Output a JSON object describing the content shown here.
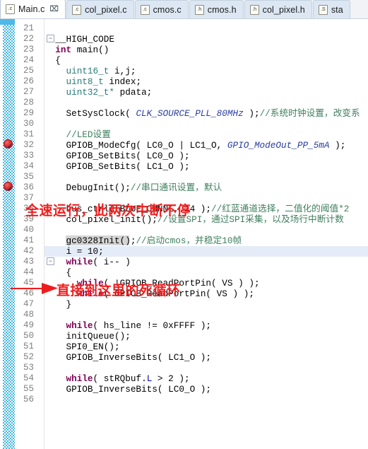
{
  "window": {
    "title": "Main.c - C/C++ Editor"
  },
  "tabs": [
    {
      "label": "Main.c",
      "icon": "c-file-icon",
      "icon_glyph": ".c",
      "active": true,
      "closable": true
    },
    {
      "label": "col_pixel.c",
      "icon": "c-file-icon",
      "icon_glyph": ".c",
      "active": false,
      "closable": false
    },
    {
      "label": "cmos.c",
      "icon": "c-file-icon",
      "icon_glyph": ".c",
      "active": false,
      "closable": false
    },
    {
      "label": "cmos.h",
      "icon": "h-file-icon",
      "icon_glyph": ".h",
      "active": false,
      "closable": false
    },
    {
      "label": "col_pixel.h",
      "icon": "h-file-icon",
      "icon_glyph": ".h",
      "active": false,
      "closable": false
    },
    {
      "label": "sta",
      "icon": "s-file-icon",
      "icon_glyph": ".S",
      "active": false,
      "closable": false
    }
  ],
  "editor": {
    "close_glyph": "⌧",
    "fold_glyph": "⊖",
    "breakpoint_lines": [
      32,
      36
    ],
    "selected_line": 42,
    "occurrence_highlight_line": 41,
    "first_visible_line": 21,
    "lines": [
      {
        "n": 21,
        "fold": false,
        "segments": []
      },
      {
        "n": 22,
        "fold": true,
        "segments": [
          {
            "t": "  __HIGH_CODE",
            "c": "mac"
          }
        ]
      },
      {
        "n": 23,
        "fold": false,
        "segments": [
          {
            "t": "  ",
            "c": "plain"
          },
          {
            "t": "int",
            "c": "kw"
          },
          {
            "t": " main()",
            "c": "plain"
          }
        ]
      },
      {
        "n": 24,
        "fold": false,
        "segments": [
          {
            "t": "  {",
            "c": "plain"
          }
        ]
      },
      {
        "n": 25,
        "fold": false,
        "segments": [
          {
            "t": "    ",
            "c": "plain"
          },
          {
            "t": "uint16_t",
            "c": "typ"
          },
          {
            "t": " i,j;",
            "c": "plain"
          }
        ]
      },
      {
        "n": 26,
        "fold": false,
        "segments": [
          {
            "t": "    ",
            "c": "plain"
          },
          {
            "t": "uint8_t",
            "c": "typ"
          },
          {
            "t": " index;",
            "c": "plain"
          }
        ]
      },
      {
        "n": 27,
        "fold": false,
        "segments": [
          {
            "t": "    ",
            "c": "plain"
          },
          {
            "t": "uint32_t*",
            "c": "typ"
          },
          {
            "t": " pdata;",
            "c": "plain"
          }
        ]
      },
      {
        "n": 28,
        "fold": false,
        "segments": []
      },
      {
        "n": 29,
        "fold": false,
        "segments": [
          {
            "t": "    SetSysClock( ",
            "c": "plain"
          },
          {
            "t": "CLK_SOURCE_PLL_80MHz",
            "c": "cnst"
          },
          {
            "t": " );",
            "c": "plain"
          },
          {
            "t": "//系统时钟设置，改变系",
            "c": "cmt"
          }
        ]
      },
      {
        "n": 30,
        "fold": false,
        "segments": []
      },
      {
        "n": 31,
        "fold": false,
        "segments": [
          {
            "t": "    ",
            "c": "plain"
          },
          {
            "t": "//LED设置",
            "c": "cmt"
          }
        ]
      },
      {
        "n": 32,
        "fold": false,
        "segments": [
          {
            "t": "    GPIOB_ModeCfg( LC0_O | LC1_O, ",
            "c": "plain"
          },
          {
            "t": "GPIO_ModeOut_PP_5mA",
            "c": "cnst"
          },
          {
            "t": " );",
            "c": "plain"
          }
        ]
      },
      {
        "n": 33,
        "fold": false,
        "segments": [
          {
            "t": "    GPIOB_SetBits( LC0_O );",
            "c": "plain"
          }
        ]
      },
      {
        "n": 34,
        "fold": false,
        "segments": [
          {
            "t": "    GPIOB_SetBits( LC1_O );",
            "c": "plain"
          }
        ]
      },
      {
        "n": 35,
        "fold": false,
        "segments": []
      },
      {
        "n": 36,
        "fold": false,
        "segments": [
          {
            "t": "    DebugInit();",
            "c": "plain"
          },
          {
            "t": "//串口通讯设置，默认",
            "c": "cmt"
          }
        ]
      },
      {
        "n": 37,
        "fold": false,
        "segments": []
      },
      {
        "n": 38,
        "fold": false,
        "segments": [
          {
            "t": "    bus_ctrl( BLUE_CHNNL, 14 );",
            "c": "plain"
          },
          {
            "t": "//红蓝通道选择，二值化的阈值*2",
            "c": "cmt"
          }
        ]
      },
      {
        "n": 39,
        "fold": false,
        "segments": [
          {
            "t": "    col_pixel_init();",
            "c": "plain"
          },
          {
            "t": "//设置SPI，通过SPI采集，以及场行中断计数",
            "c": "cmt"
          }
        ]
      },
      {
        "n": 40,
        "fold": false,
        "segments": []
      },
      {
        "n": 41,
        "fold": false,
        "segments": [
          {
            "t": "    gc0328Init();",
            "c": "plain"
          },
          {
            "t": "//启动cmos，并稳定10帧",
            "c": "cmt"
          }
        ]
      },
      {
        "n": 42,
        "fold": false,
        "segments": [
          {
            "t": "    i = 10;",
            "c": "plain"
          }
        ]
      },
      {
        "n": 43,
        "fold": true,
        "segments": [
          {
            "t": "    ",
            "c": "plain"
          },
          {
            "t": "while",
            "c": "kw"
          },
          {
            "t": "( i-- )",
            "c": "plain"
          }
        ]
      },
      {
        "n": 44,
        "fold": false,
        "segments": [
          {
            "t": "    {",
            "c": "plain"
          }
        ]
      },
      {
        "n": 45,
        "fold": false,
        "segments": [
          {
            "t": "      ",
            "c": "plain"
          },
          {
            "t": "while",
            "c": "kw"
          },
          {
            "t": "( !GPIOB_ReadPortPin( VS ) );",
            "c": "plain"
          }
        ]
      },
      {
        "n": 46,
        "fold": false,
        "segments": [
          {
            "t": "      ",
            "c": "plain"
          },
          {
            "t": "while",
            "c": "kw"
          },
          {
            "t": "( GPIOB_ReadPortPin( VS ) );",
            "c": "plain"
          }
        ]
      },
      {
        "n": 47,
        "fold": false,
        "segments": [
          {
            "t": "    }",
            "c": "plain"
          }
        ]
      },
      {
        "n": 48,
        "fold": false,
        "segments": []
      },
      {
        "n": 49,
        "fold": false,
        "segments": [
          {
            "t": "    ",
            "c": "plain"
          },
          {
            "t": "while",
            "c": "kw"
          },
          {
            "t": "( hs_line != 0xFFFF );",
            "c": "plain"
          }
        ]
      },
      {
        "n": 50,
        "fold": false,
        "segments": [
          {
            "t": "    initQueue();",
            "c": "plain"
          }
        ]
      },
      {
        "n": 51,
        "fold": false,
        "segments": [
          {
            "t": "    SPI0_EN();",
            "c": "plain"
          }
        ]
      },
      {
        "n": 52,
        "fold": false,
        "segments": [
          {
            "t": "    GPIOB_InverseBits( LC1_O );",
            "c": "plain"
          }
        ]
      },
      {
        "n": 53,
        "fold": false,
        "segments": []
      },
      {
        "n": 54,
        "fold": false,
        "segments": [
          {
            "t": "    ",
            "c": "plain"
          },
          {
            "t": "while",
            "c": "kw"
          },
          {
            "t": "( stRQbuf.",
            "c": "plain"
          },
          {
            "t": "L",
            "c": "fld"
          },
          {
            "t": " > 2 );",
            "c": "plain"
          }
        ]
      },
      {
        "n": 55,
        "fold": false,
        "segments": [
          {
            "t": "    GPIOB_InverseBits( LC0_O );",
            "c": "plain"
          }
        ]
      },
      {
        "n": 56,
        "fold": false,
        "segments": []
      }
    ]
  },
  "annotations": [
    {
      "id": "annot-full-speed",
      "text": "全速运行，此两次中断不停",
      "color": "#ef1e1e"
    },
    {
      "id": "annot-dead-loop",
      "text": "直接到这里的死循环",
      "color": "#ef1e1e"
    }
  ],
  "colors": {
    "breakpoint": "#e03030",
    "annotation": "#ef1e1e",
    "gutter": "#41b6e6",
    "selection": "#e4ecf7",
    "occurrence": "#d4d4d4",
    "keyword": "#7f0055",
    "comment": "#3f7f5f",
    "type": "#2a7a7a",
    "constant": "#2a3f9e",
    "tab_active": "#ffffff",
    "tab_inactive": "#dce7f3"
  }
}
